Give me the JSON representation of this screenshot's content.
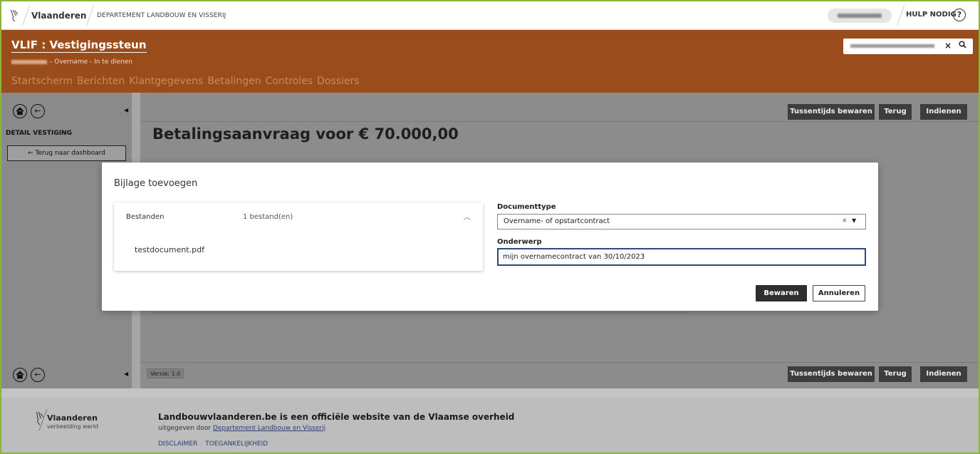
{
  "global_header": {
    "brand": "Vlaanderen",
    "department": "DEPARTEMENT LANDBOUW EN VISSERIJ",
    "help": "HULP NODIG",
    "help_icon": "?"
  },
  "app_header": {
    "title": "VLIF : Vestigingssteun",
    "subtitle": "- Overname - In te dienen",
    "nav": [
      "Startscherm",
      "Berichten",
      "Klantgegevens",
      "Betalingen",
      "Controles",
      "Dossiers"
    ],
    "search_clear": "×",
    "search_icon": "magnifier"
  },
  "sidebar": {
    "section_label": "DETAIL VESTIGING",
    "back_button": "← Terug naar dashboard"
  },
  "toolbar": {
    "save_interim": "Tussentijds bewaren",
    "back": "Terug",
    "submit": "Indienen"
  },
  "main": {
    "heading": "Betalingsaanvraag voor € 70.000,00",
    "version": "Versie: 1.0"
  },
  "modal": {
    "title": "Bijlage toevoegen",
    "files_label": "Bestanden",
    "files_count": "1 bestand(en)",
    "file_name": "testdocument.pdf",
    "doc_type_label": "Documenttype",
    "doc_type_value": "Overname- of opstartcontract",
    "subject_label": "Onderwerp",
    "subject_value": "mijn overnamecontract van 30/10/2023",
    "save": "Bewaren",
    "cancel": "Annuleren"
  },
  "footer": {
    "brand": "Vlaanderen",
    "tagline": "verbeelding werkt",
    "title": "Landbouwvlaanderen.be is een officiële website van de Vlaamse overheid",
    "published_by": "uitgegeven door",
    "published_link": "Departement Landbouw en Visserij",
    "links": [
      "DISCLAIMER",
      "TOEGANKELIJKHEID"
    ]
  },
  "colors": {
    "app_header_bg": "#9a4d1a",
    "frame_border": "#8db33a",
    "primary_button": "#2e2e2e",
    "input_focus": "#2a4a7a"
  }
}
